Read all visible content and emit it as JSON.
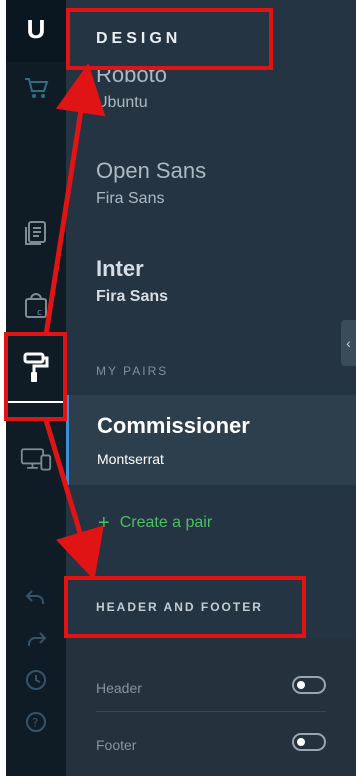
{
  "app": {
    "logo": "U"
  },
  "panel": {
    "title": "DESIGN",
    "font_pairs": [
      {
        "heading": "Roboto",
        "body": "Ubuntu"
      },
      {
        "heading": "Open Sans",
        "body": "Fira Sans"
      },
      {
        "heading": "Inter",
        "body": "Fira Sans"
      }
    ],
    "my_pairs_label": "MY PAIRS",
    "selected_pair": {
      "heading": "Commissioner",
      "body": "Montserrat"
    },
    "create_pair_label": "Create a pair",
    "header_footer_title": "HEADER AND FOOTER",
    "rows": [
      {
        "label": "Header",
        "enabled": false
      },
      {
        "label": "Footer",
        "enabled": false
      }
    ]
  },
  "icons": {
    "rail": [
      "cart-icon",
      "pages-icon",
      "apps-icon",
      "paint-roller-icon",
      "devices-icon",
      "undo-icon",
      "redo-icon",
      "history-icon",
      "help-icon"
    ],
    "collapse": "chevron-left-icon"
  },
  "colors": {
    "rail_bg": "#0f1c26",
    "panel_bg": "#243443",
    "accent_green": "#4cbf63",
    "selection_border": "#3b8fd9",
    "annotation_red": "#e01414"
  }
}
